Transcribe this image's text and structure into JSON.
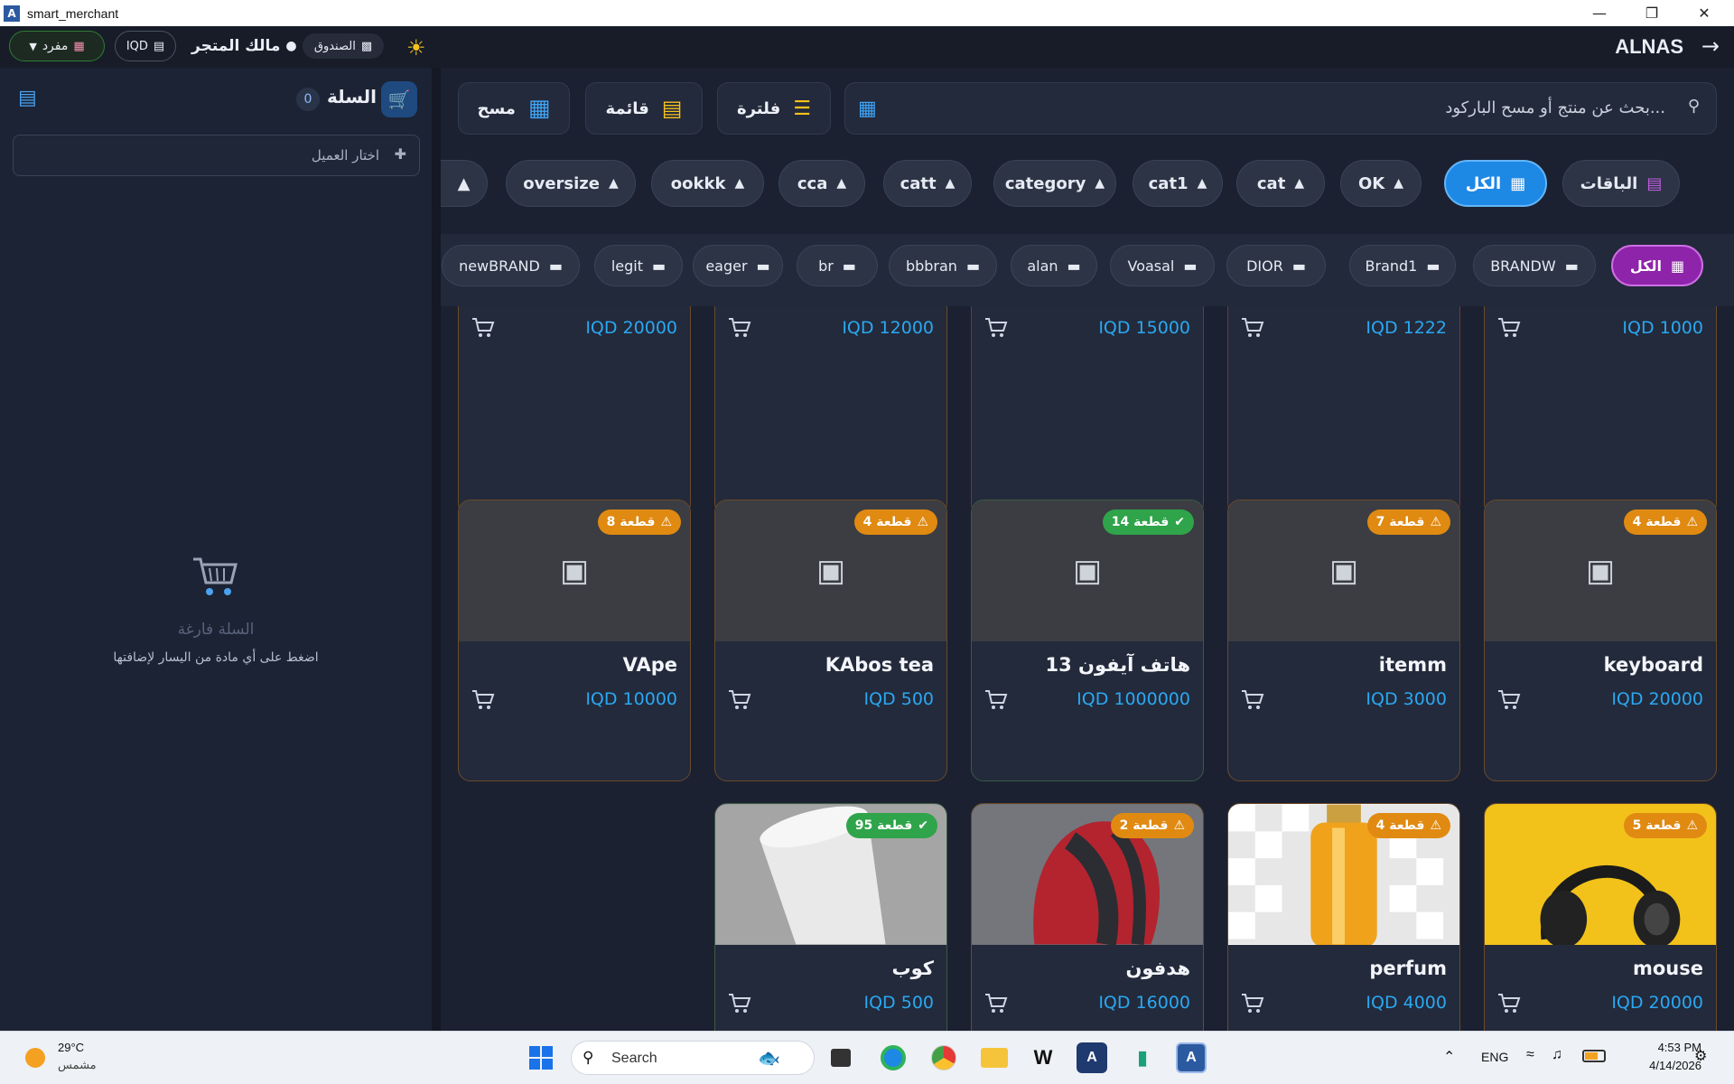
{
  "window": {
    "title": "smart_merchant"
  },
  "header": {
    "brand": "ALNAS",
    "mode_label": "مفرد",
    "currency_label": "IQD",
    "user_label": "مالك المتجر",
    "register_label": "الصندوق"
  },
  "cart": {
    "title": "السلة",
    "count": "0",
    "customer_placeholder": "اختار العميل",
    "empty_title": "السلة فارغة",
    "empty_hint": "اضغط على أي مادة من اليسار لإضافتها"
  },
  "toolbar": {
    "search_placeholder": "بحث عن منتج أو مسح الباركود...",
    "filter_label": "فلترة",
    "list_label": "قائمة",
    "scan_label": "مسح"
  },
  "categories": [
    {
      "label": "الباقات",
      "icon": "gift-icon"
    },
    {
      "label": "الكل",
      "icon": "grid-icon",
      "active": true
    },
    {
      "label": "OK"
    },
    {
      "label": "cat"
    },
    {
      "label": "cat1"
    },
    {
      "label": "category"
    },
    {
      "label": "catt"
    },
    {
      "label": "cca"
    },
    {
      "label": "ookkk"
    },
    {
      "label": "oversize"
    }
  ],
  "brands": [
    {
      "label": "الكل",
      "active": true
    },
    {
      "label": "BRANDW"
    },
    {
      "label": "Brand1"
    },
    {
      "label": "DIOR"
    },
    {
      "label": "Voasal"
    },
    {
      "label": "alan"
    },
    {
      "label": "bbbran"
    },
    {
      "label": "br"
    },
    {
      "label": "eager"
    },
    {
      "label": "legit"
    },
    {
      "label": "newBRAND"
    }
  ],
  "products_top_row": [
    {
      "price": "IQD 1000"
    },
    {
      "price": "IQD 1222"
    },
    {
      "price": "IQD 15000"
    },
    {
      "price": "IQD 12000"
    },
    {
      "price": "IQD 20000"
    }
  ],
  "products": [
    {
      "name": "keyboard",
      "price": "IQD 20000",
      "stock": "4 قطعة",
      "low": true
    },
    {
      "name": "itemm",
      "price": "IQD 3000",
      "stock": "7 قطعة",
      "low": true
    },
    {
      "name": "هاتف آيفون 13",
      "price": "IQD 1000000",
      "stock": "14 قطعة",
      "low": false
    },
    {
      "name": "KAbos tea",
      "price": "IQD 500",
      "stock": "4 قطعة",
      "low": true
    },
    {
      "name": "VApe",
      "price": "IQD 10000",
      "stock": "8 قطعة",
      "low": true
    },
    {
      "name": "mouse",
      "price": "IQD 20000",
      "stock": "5 قطعة",
      "low": true,
      "image": "headphones"
    },
    {
      "name": "perfum",
      "price": "IQD 4000",
      "stock": "4 قطعة",
      "low": true,
      "image": "perfume"
    },
    {
      "name": "هدفون",
      "price": "IQD 16000",
      "stock": "2 قطعة",
      "low": true,
      "image": "headset"
    },
    {
      "name": "كوب",
      "price": "IQD 500",
      "stock": "95 قطعة",
      "low": false,
      "image": "cup"
    }
  ],
  "taskbar": {
    "temperature": "29°C",
    "weather": "مشمس",
    "search_placeholder": "Search",
    "language": "ENG",
    "time": "4:53 PM",
    "date": "4/14/2026"
  },
  "colors": {
    "accent_blue": "#1e88e5",
    "accent_purple": "#8e24aa",
    "warning": "#e08a12",
    "success": "#2fa44a",
    "price": "#2aa8f2"
  }
}
